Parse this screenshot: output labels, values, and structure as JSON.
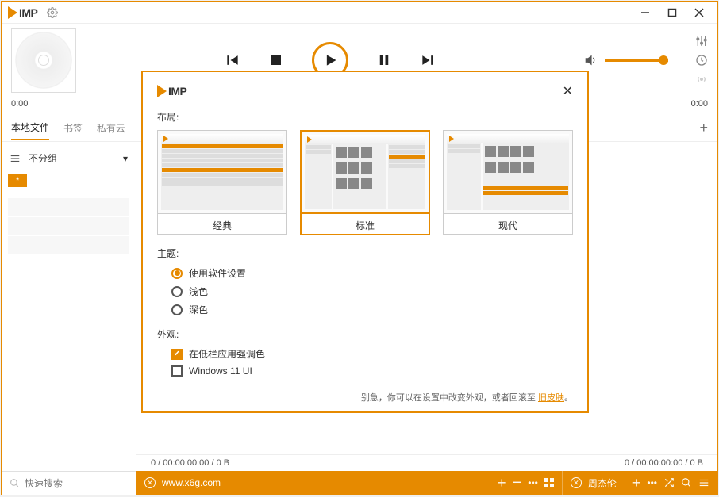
{
  "app": {
    "name": "IMP"
  },
  "window_controls": {
    "min": "minimize",
    "max": "maximize",
    "close": "close"
  },
  "player": {
    "time_current": "0:00",
    "time_total": "0:00"
  },
  "tabs": {
    "items": [
      "本地文件",
      "书签",
      "私有云"
    ],
    "active": 0
  },
  "left": {
    "group_label": "不分组",
    "chip": "*"
  },
  "footer": {
    "left_stats": "0 / 00:00:00:00 / 0 B",
    "right_stats": "0 / 00:00:00:00 / 0 B"
  },
  "bottom": {
    "search_placeholder": "快速搜索",
    "url": "www.x6g.com",
    "tab2": "周杰伦"
  },
  "dialog": {
    "title": "IMP",
    "layout_label": "布局:",
    "layouts": [
      "经典",
      "标准",
      "现代"
    ],
    "selected_layout": 1,
    "theme_label": "主题:",
    "themes": [
      "使用软件设置",
      "浅色",
      "深色"
    ],
    "selected_theme": 0,
    "appearance_label": "外观:",
    "appearance_opts": [
      "在低栏应用强调色",
      "Windows 11 UI"
    ],
    "appearance_checked": [
      true,
      false
    ],
    "foot_prefix": "别急，你可以在设置中改变外观，或者回滚至 ",
    "foot_link": "旧皮肤",
    "foot_suffix": "。"
  }
}
